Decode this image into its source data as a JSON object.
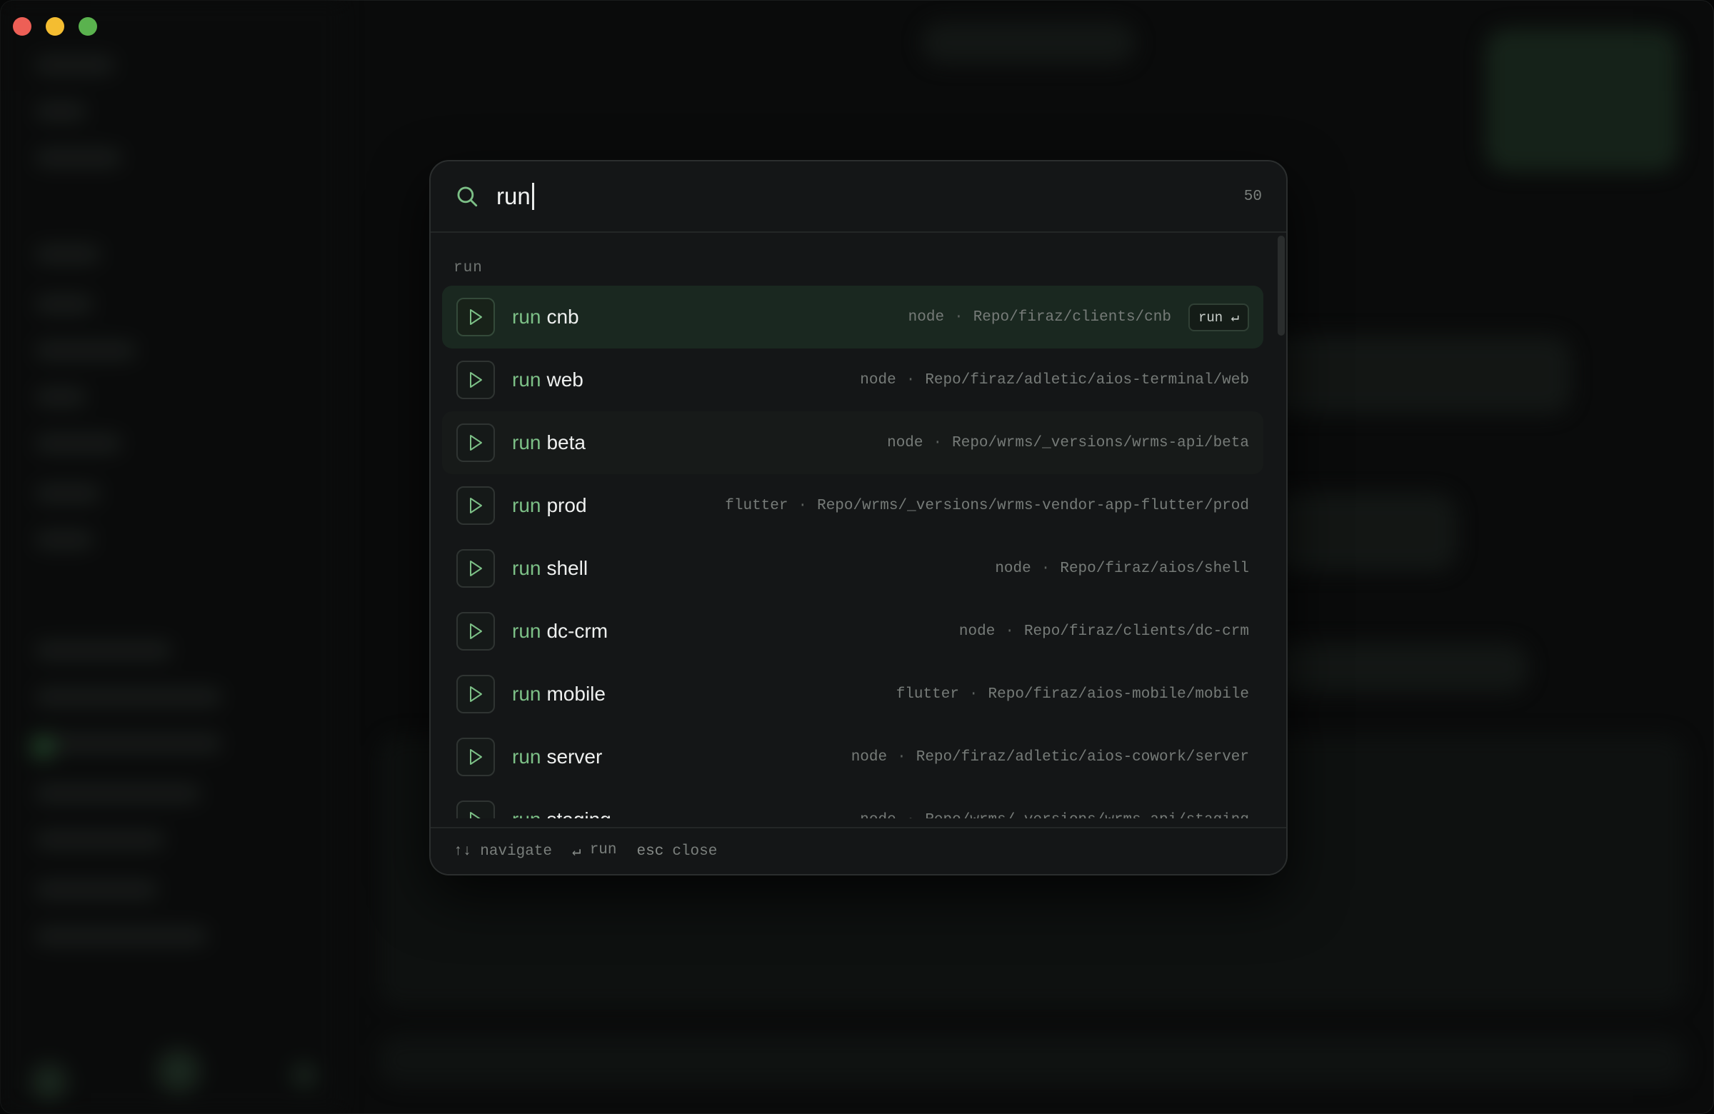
{
  "search": {
    "query": "run",
    "result_count": "50"
  },
  "section": {
    "label": "run"
  },
  "results": [
    {
      "keyword": "run",
      "name": "cnb",
      "runtime": "node",
      "path": "Repo/firaz/clients/cnb",
      "badge": "run ↵",
      "state": "active"
    },
    {
      "keyword": "run",
      "name": "web",
      "runtime": "node",
      "path": "Repo/firaz/adletic/aios-terminal/web",
      "state": ""
    },
    {
      "keyword": "run",
      "name": "beta",
      "runtime": "node",
      "path": "Repo/wrms/_versions/wrms-api/beta",
      "state": "hover"
    },
    {
      "keyword": "run",
      "name": "prod",
      "runtime": "flutter",
      "path": "Repo/wrms/_versions/wrms-vendor-app-flutter/prod",
      "state": ""
    },
    {
      "keyword": "run",
      "name": "shell",
      "runtime": "node",
      "path": "Repo/firaz/aios/shell",
      "state": ""
    },
    {
      "keyword": "run",
      "name": "dc-crm",
      "runtime": "node",
      "path": "Repo/firaz/clients/dc-crm",
      "state": ""
    },
    {
      "keyword": "run",
      "name": "mobile",
      "runtime": "flutter",
      "path": "Repo/firaz/aios-mobile/mobile",
      "state": ""
    },
    {
      "keyword": "run",
      "name": "server",
      "runtime": "node",
      "path": "Repo/firaz/adletic/aios-cowork/server",
      "state": ""
    },
    {
      "keyword": "run",
      "name": "staging",
      "runtime": "node",
      "path": "Repo/wrms/_versions/wrms-api/staging",
      "state": ""
    }
  ],
  "footer": {
    "navigate_key": "↑↓",
    "navigate_label": "navigate",
    "run_key": "↵",
    "run_label": "run",
    "close_key": "esc",
    "close_label": "close"
  },
  "icons": {
    "search": "search-icon",
    "play": "play-icon"
  },
  "colors": {
    "accent": "#7cbf86",
    "active_row": "#1a2820",
    "palette_bg": "#141617"
  }
}
